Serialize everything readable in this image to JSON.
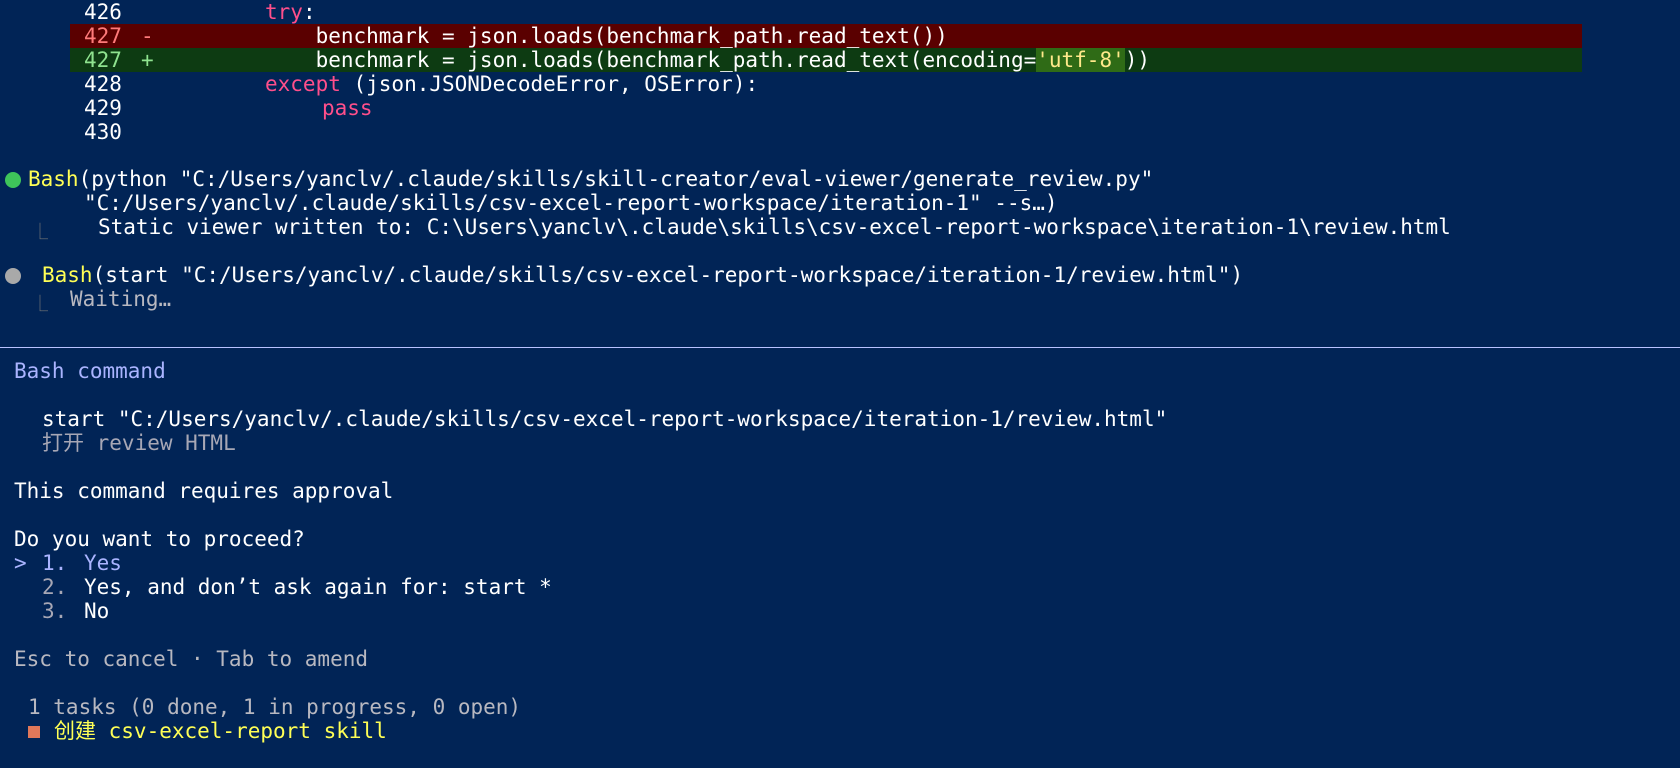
{
  "diff": {
    "lines": [
      {
        "no": "426",
        "sign": "",
        "code_indent": "",
        "kw": "try",
        "rest": ":"
      },
      {
        "no": "427",
        "sign": "-",
        "code": "    benchmark = json.loads(benchmark_path.read_text())"
      },
      {
        "no": "427",
        "sign": "+",
        "code_pre": "    benchmark = json.loads(benchmark_path.read_text(encoding=",
        "code_hl": "'utf-8'",
        "code_post": "))"
      },
      {
        "no": "428",
        "kw": "except",
        "rest": " (json.JSONDecodeError, OSError):"
      },
      {
        "no": "429",
        "kw": "pass"
      },
      {
        "no": "430"
      }
    ]
  },
  "tool_calls": [
    {
      "name": "Bash",
      "arg_line1": "(python \"C:/Users/yanclv/.claude/skills/skill-creator/eval-viewer/generate_review.py\"",
      "arg_line2": "\"C:/Users/yanclv/.claude/skills/csv-excel-report-workspace/iteration-1\" --s…)",
      "result": "Static viewer written to: C:\\Users\\yanclv\\.claude\\skills\\csv-excel-report-workspace\\iteration-1\\review.html",
      "status_color": "#3ec45a"
    },
    {
      "name": "Bash",
      "arg_line1": "(start \"C:/Users/yanclv/.claude/skills/csv-excel-report-workspace/iteration-1/review.html\")",
      "result": "Waiting…",
      "status_color": "#a9a9a9"
    }
  ],
  "prompt": {
    "heading": "Bash command",
    "command": "start \"C:/Users/yanclv/.claude/skills/csv-excel-report-workspace/iteration-1/review.html\"",
    "description": "打开 review HTML",
    "approval_note": "This command requires approval",
    "question": "Do you want to proceed?",
    "cursor": ">",
    "options": [
      {
        "num": "1.",
        "label": "Yes"
      },
      {
        "num": "2.",
        "label": "Yes, and don’t ask again for: start *"
      },
      {
        "num": "3.",
        "label": "No"
      }
    ],
    "hint": "Esc to cancel · Tab to amend"
  },
  "tasks": {
    "summary": "1 tasks (0 done, 1 in progress, 0 open)",
    "items": [
      {
        "label": "创建 csv-excel-report skill",
        "status": "in-progress"
      }
    ]
  }
}
